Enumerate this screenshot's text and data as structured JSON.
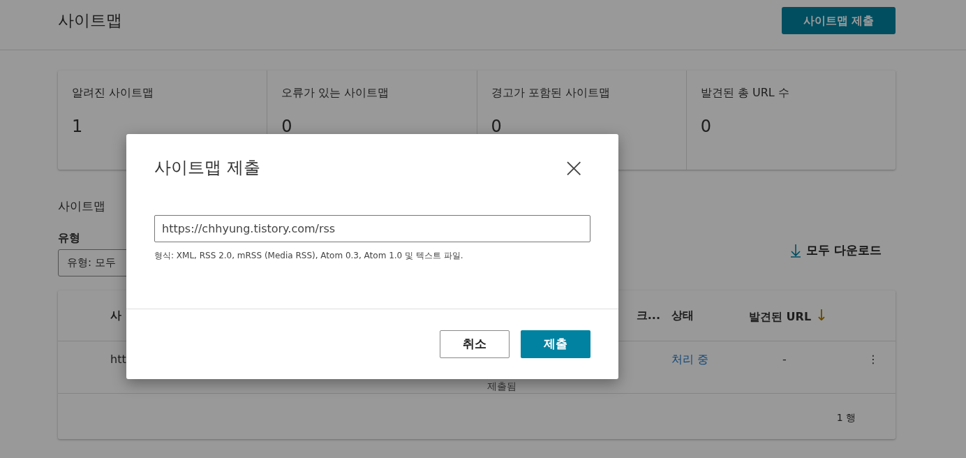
{
  "header": {
    "title": "사이트맵",
    "submit_button": "사이트맵 제출"
  },
  "stats": [
    {
      "label": "알려진 사이트맵",
      "value": "1"
    },
    {
      "label": "오류가 있는 사이트맵",
      "value": "0"
    },
    {
      "label": "경고가 포함된 사이트맵",
      "value": "0"
    },
    {
      "label": "발견된 총 URL 수",
      "value": "0"
    }
  ],
  "section": {
    "title": "사이트맵",
    "filter_label": "유형",
    "filter_value": "유형: 모두",
    "download_button": "모두 다운로드"
  },
  "table": {
    "columns": [
      {
        "label": "사"
      },
      {
        "label": "크..."
      },
      {
        "label": "상태"
      },
      {
        "label": "발견된 URL",
        "sort": "↓"
      }
    ],
    "rows": [
      {
        "cells": [
          "htt",
          "제출됨",
          "처리 중",
          "-"
        ],
        "menu": "⋮"
      }
    ],
    "footer": "1 행"
  },
  "dialog": {
    "title": "사이트맵 제출",
    "close": "×",
    "value": "https://chhyung.tistory.com/rss",
    "hint": "형식: XML, RSS 2.0, mRSS (Media RSS), Atom 0.3, Atom 1.0 및 텍스트 파일.",
    "buttons": [
      {
        "label": "취소",
        "kind": "secondary"
      },
      {
        "label": "제출",
        "kind": "primary"
      }
    ]
  }
}
